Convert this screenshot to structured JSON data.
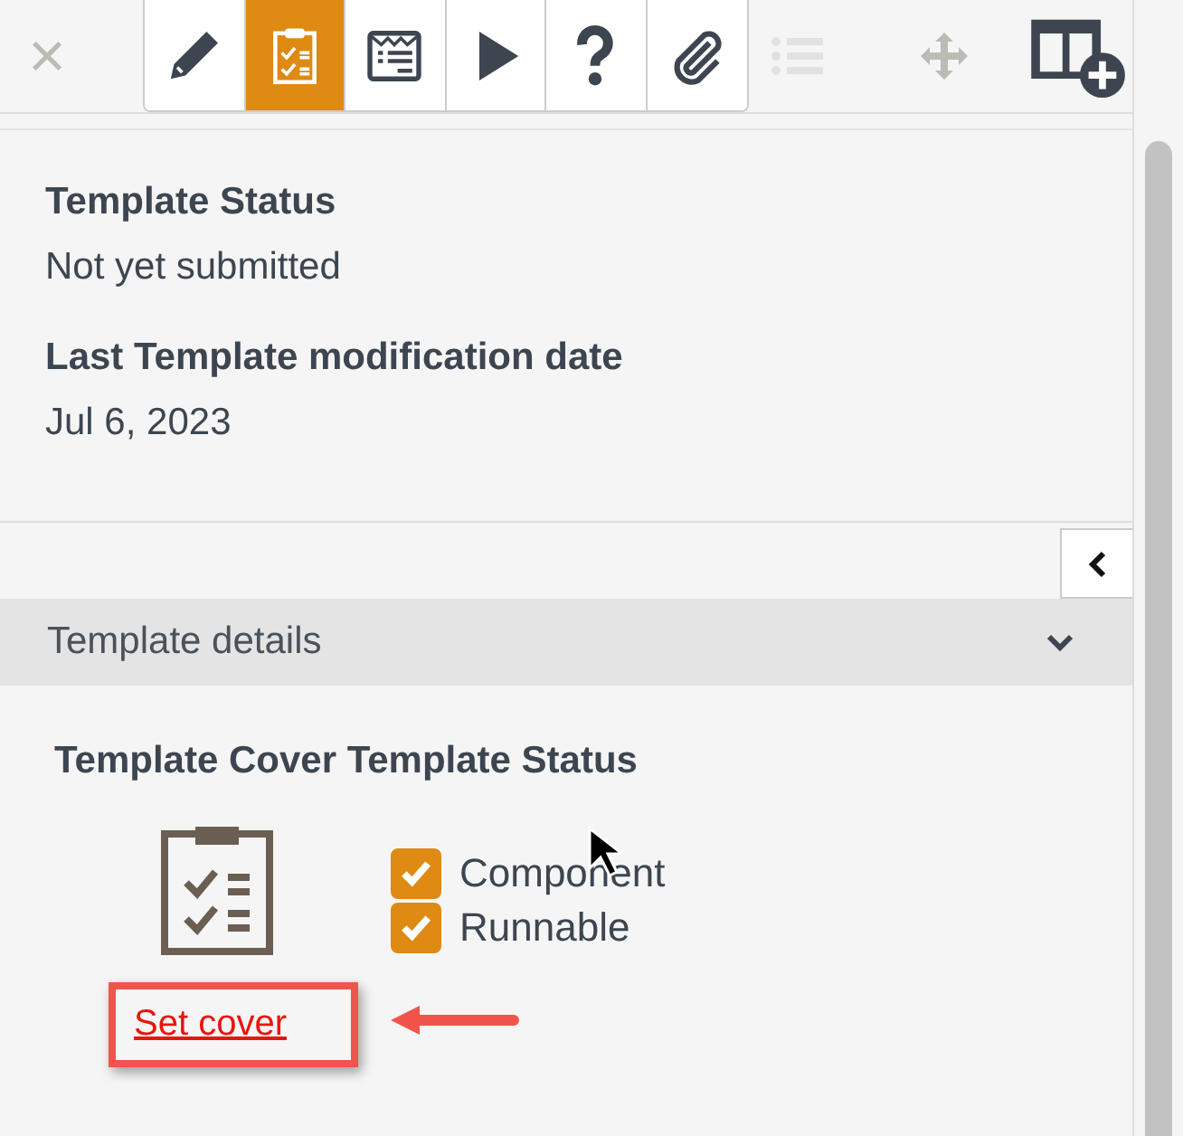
{
  "toolbar": {
    "close": "×",
    "tools": [
      {
        "kind": "pencil",
        "selected": false
      },
      {
        "kind": "clipboard",
        "selected": true
      },
      {
        "kind": "form",
        "selected": false
      },
      {
        "kind": "play",
        "selected": false
      },
      {
        "kind": "help",
        "selected": false
      },
      {
        "kind": "clip",
        "selected": false
      }
    ],
    "extras": [
      {
        "kind": "list",
        "disabled": true
      },
      {
        "kind": "move",
        "disabled": false
      },
      {
        "kind": "layout-add",
        "disabled": false
      }
    ]
  },
  "fields": [
    {
      "label": "Template Status",
      "value": "Not yet submitted"
    },
    {
      "label": "Last Template modification date",
      "value": "Jul 6, 2023"
    }
  ],
  "details": {
    "title": "Template details",
    "expanded": true,
    "cover_title": "Template Cover Template Status",
    "checks": [
      {
        "label": "Component",
        "checked": true
      },
      {
        "label": "Runnable",
        "checked": true
      }
    ],
    "link": "Set cover"
  }
}
